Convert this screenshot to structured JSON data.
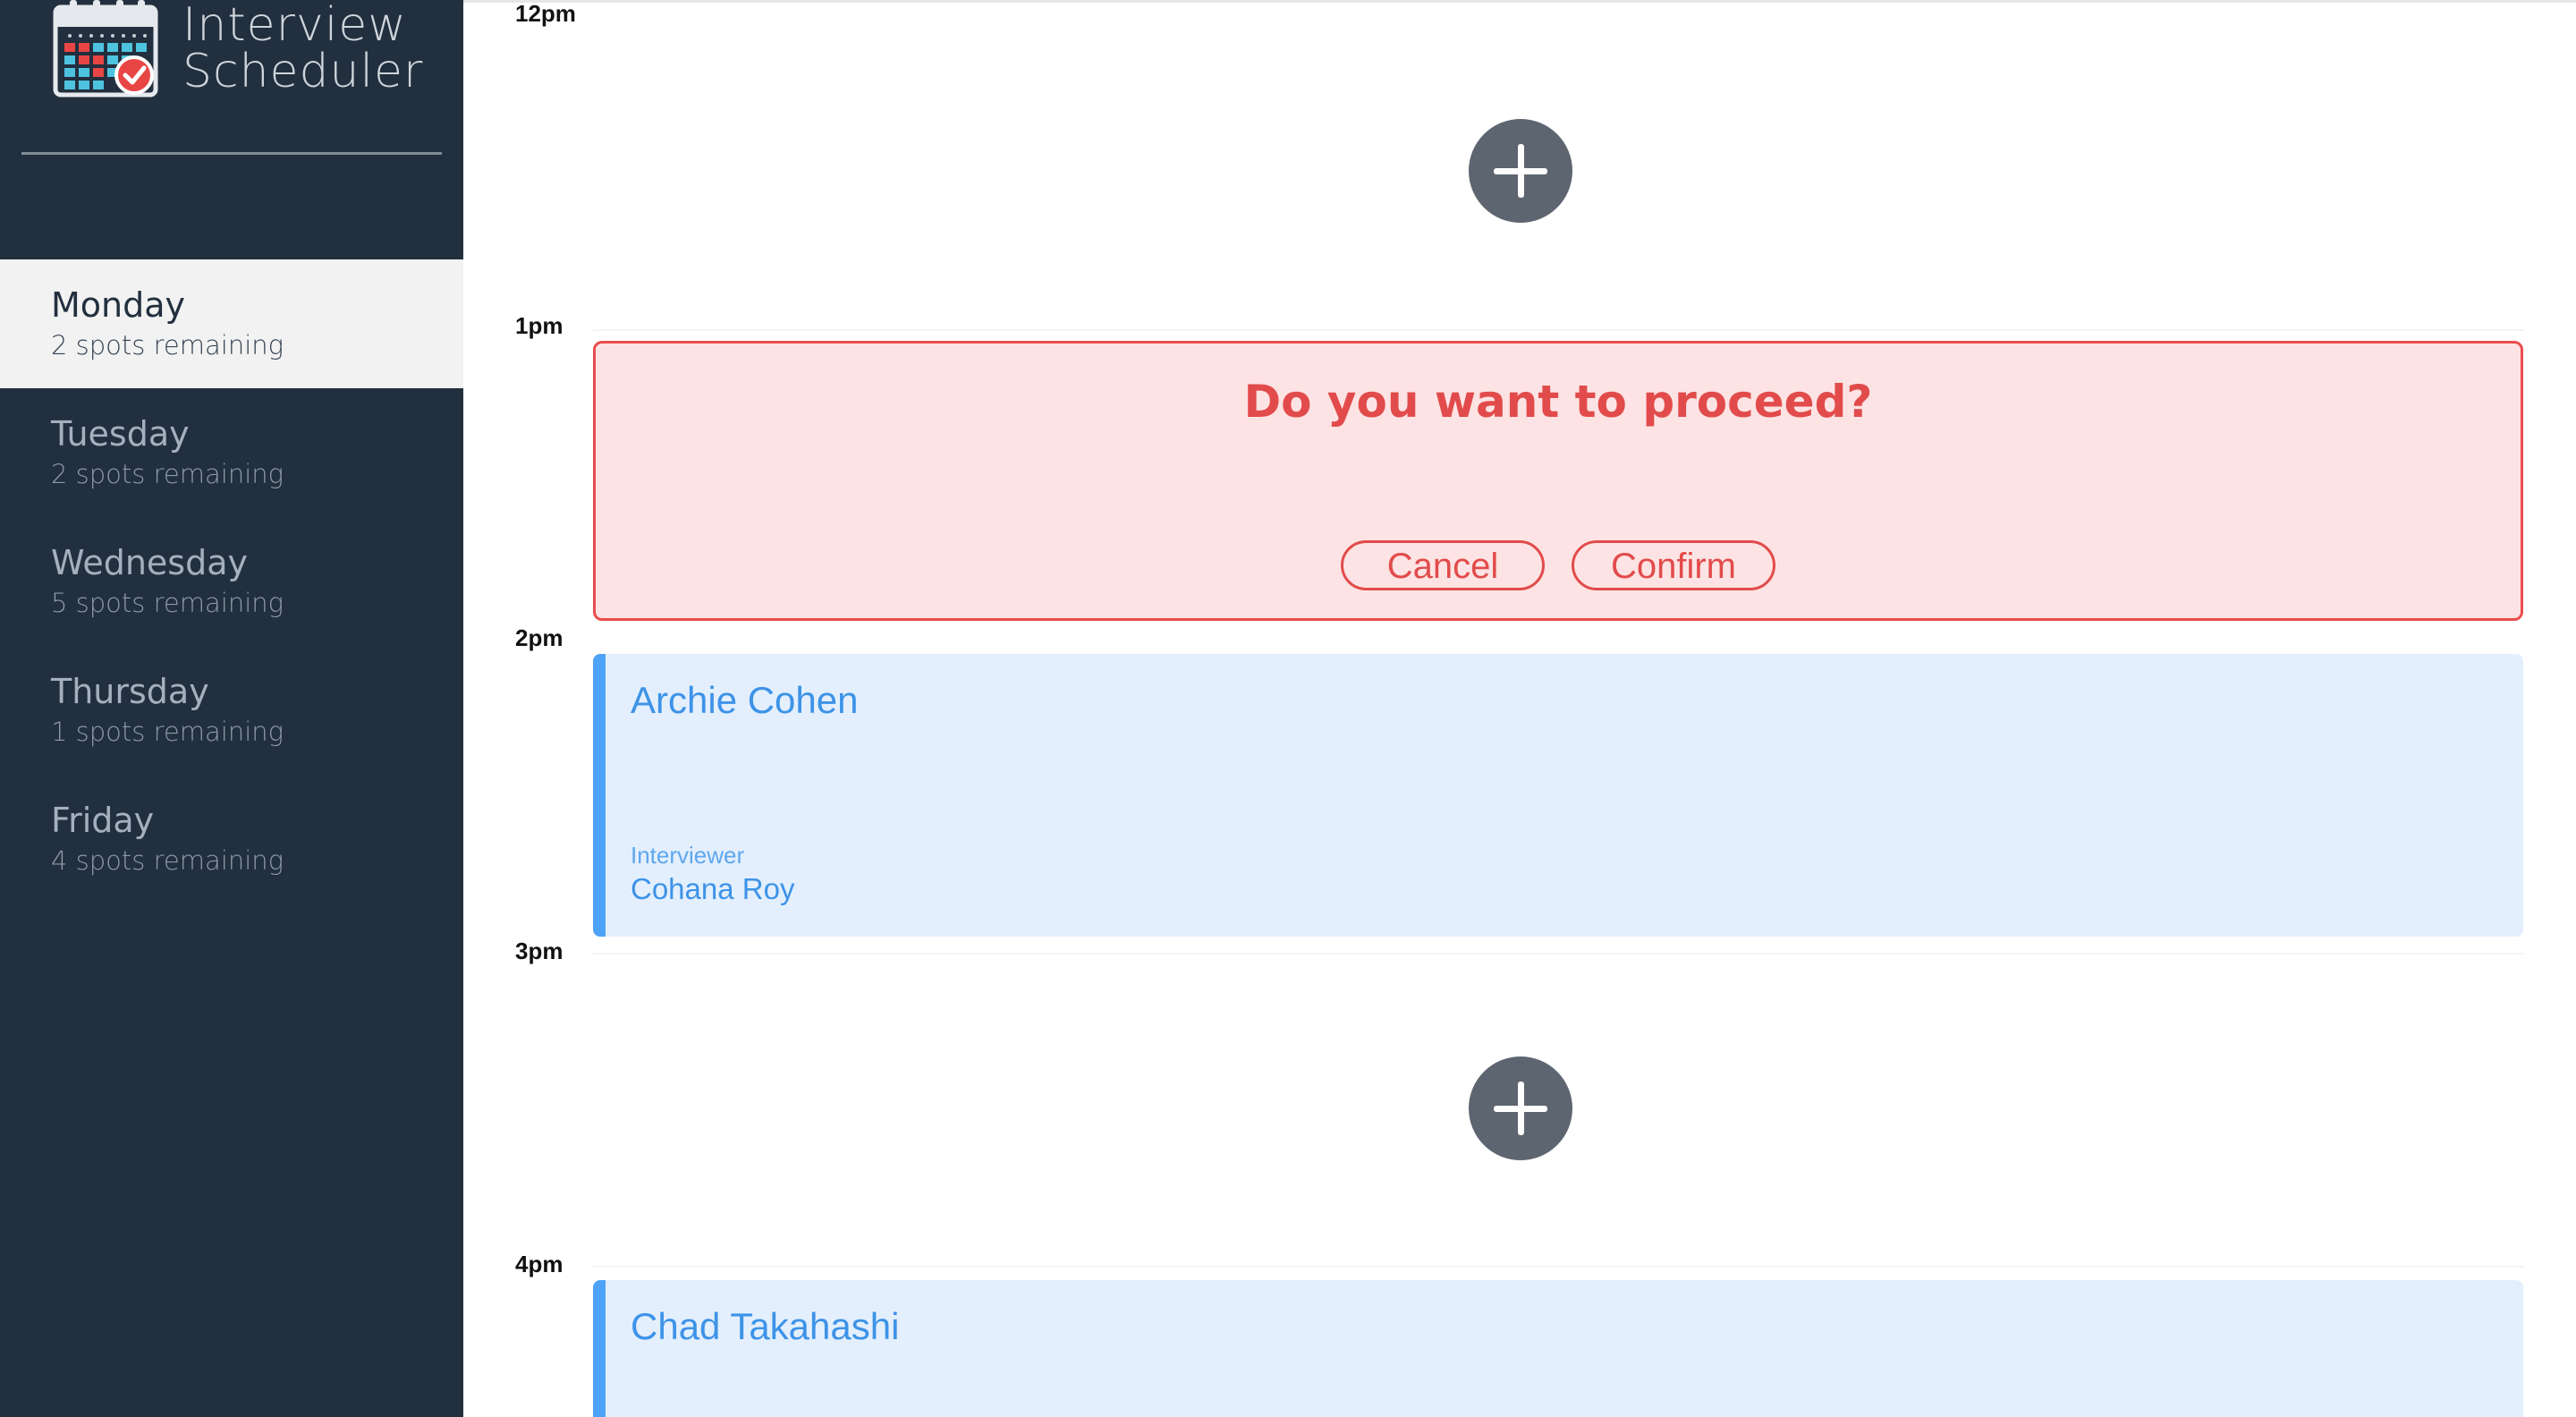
{
  "app": {
    "title_line1": "Interview",
    "title_line2": "Scheduler",
    "logo_icon": "calendar-check-icon"
  },
  "sidebar": {
    "days": [
      {
        "name": "Monday",
        "spots": "2 spots remaining",
        "selected": true
      },
      {
        "name": "Tuesday",
        "spots": "2 spots remaining",
        "selected": false
      },
      {
        "name": "Wednesday",
        "spots": "5 spots remaining",
        "selected": false
      },
      {
        "name": "Thursday",
        "spots": "1 spots remaining",
        "selected": false
      },
      {
        "name": "Friday",
        "spots": "4 spots remaining",
        "selected": false
      }
    ]
  },
  "schedule": {
    "times": [
      "12pm",
      "1pm",
      "2pm",
      "3pm",
      "4pm"
    ],
    "add_icon": "plus-circle-icon",
    "confirm": {
      "message": "Do you want to proceed?",
      "cancel_label": "Cancel",
      "confirm_label": "Confirm"
    },
    "appointments": [
      {
        "student": "Archie Cohen",
        "interviewer_label": "Interviewer",
        "interviewer": "Cohana Roy"
      },
      {
        "student": "Chad Takahashi"
      }
    ]
  },
  "colors": {
    "sidebar_bg": "#222f3e",
    "selected_bg": "#f2f2f2",
    "danger": "#e24b4b",
    "danger_bg": "#fde3e3",
    "appointment_bg": "#e3effd",
    "appointment_accent": "#4ea3f7",
    "add_button": "#5d6570"
  }
}
